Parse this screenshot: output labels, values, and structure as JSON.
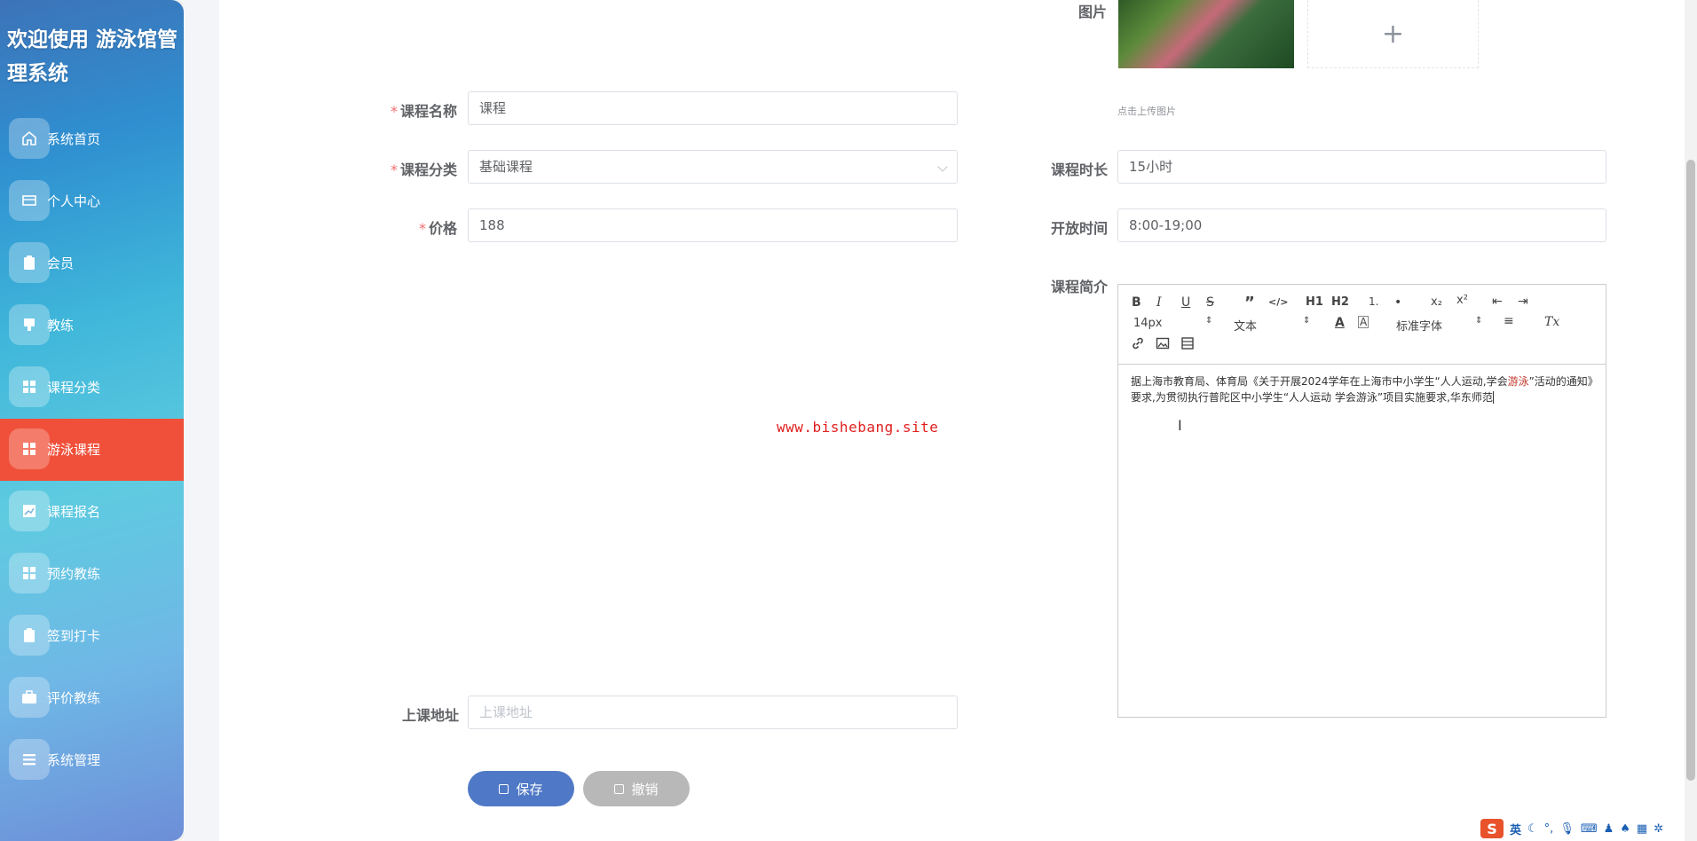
{
  "sidebar": {
    "title": "欢迎使用 游泳馆管理系统",
    "items": [
      {
        "label": "系统首页",
        "icon": "home-icon"
      },
      {
        "label": "个人中心",
        "icon": "card-icon"
      },
      {
        "label": "会员",
        "icon": "clipboard-icon"
      },
      {
        "label": "教练",
        "icon": "coach-icon"
      },
      {
        "label": "课程分类",
        "icon": "grid-icon"
      },
      {
        "label": "游泳课程",
        "icon": "grid-icon",
        "active": true
      },
      {
        "label": "课程报名",
        "icon": "chart-icon"
      },
      {
        "label": "预约教练",
        "icon": "grid-icon"
      },
      {
        "label": "签到打卡",
        "icon": "clipboard-icon"
      },
      {
        "label": "评价教练",
        "icon": "briefcase-icon"
      },
      {
        "label": "系统管理",
        "icon": "list-icon"
      }
    ]
  },
  "form": {
    "image_label": "图片",
    "upload_tip": "点击上传图片",
    "upload_plus": "+",
    "course_name": {
      "label": "课程名称",
      "value": "课程"
    },
    "category": {
      "label": "课程分类",
      "value": "基础课程"
    },
    "price": {
      "label": "价格",
      "value": "188"
    },
    "duration": {
      "label": "课程时长",
      "value": "15小时"
    },
    "open_time": {
      "label": "开放时间",
      "value": "8:00-19;00"
    },
    "intro": {
      "label": "课程简介"
    },
    "address": {
      "label": "上课地址",
      "placeholder": "上课地址"
    }
  },
  "editor": {
    "toolbar": {
      "bold": "B",
      "italic": "I",
      "underline": "U",
      "strike": "S",
      "quote": "”",
      "code": "</>",
      "h1": "H1",
      "h2": "H2",
      "ordered_list": "1.",
      "bullet_list": "•",
      "sub": "x₂",
      "sup": "x²",
      "outdent": "⇤",
      "indent": "⇥",
      "size": "14px",
      "header": "文本",
      "font": "标准字体",
      "align": "≡",
      "clear": "Tx"
    },
    "content_before": "据上海市教育局、体育局《关于开展2024学年在上海市中小学生“人人运动,学会",
    "content_highlight": "游泳",
    "content_after": "”活动的通知》要求,为贯彻执行普陀区中小学生“人人运动 学会游泳”项目实施要求,华东师范"
  },
  "watermark": "www.bishebang.site",
  "buttons": {
    "save": "保存",
    "cancel": "撤销"
  },
  "taskbar": {
    "ime": "S",
    "lang": "英"
  }
}
